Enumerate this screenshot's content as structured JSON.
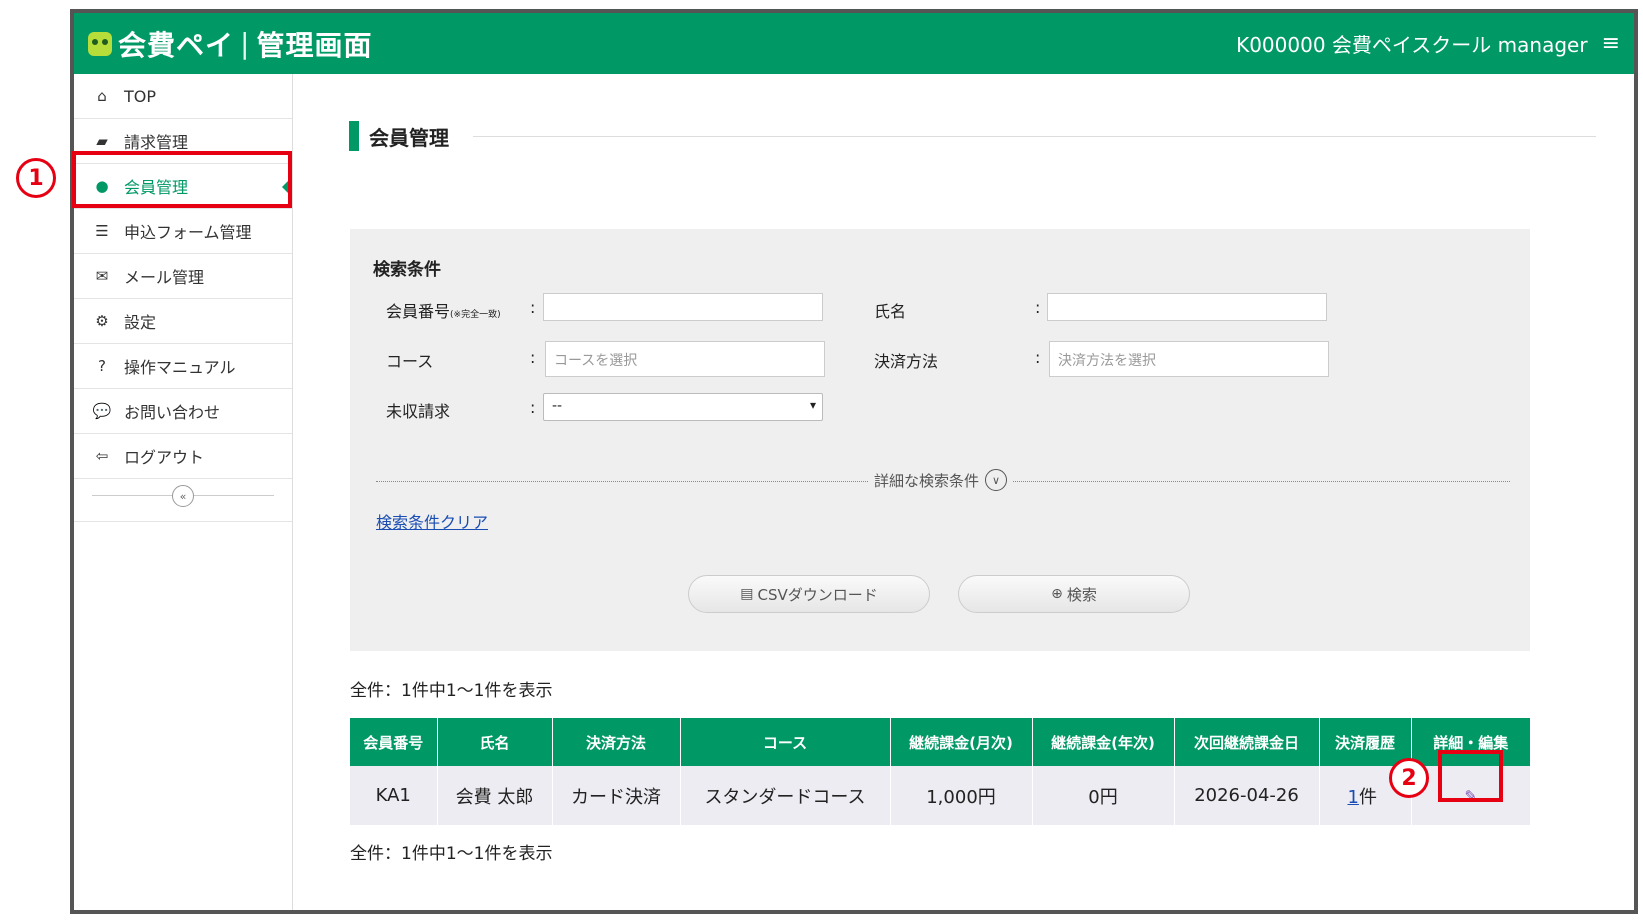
{
  "header": {
    "brand_main": "会費ペイ",
    "brand_sep": "|",
    "brand_sub": "管理画面",
    "user": "K000000 会費ペイスクール manager",
    "menu_icon": "≡"
  },
  "sidebar": {
    "items": [
      {
        "label": "TOP",
        "icon": "home-icon",
        "glyph": "⌂"
      },
      {
        "label": "請求管理",
        "icon": "book-icon",
        "glyph": "▰"
      },
      {
        "label": "会員管理",
        "icon": "user-icon",
        "glyph": "●",
        "active": true
      },
      {
        "label": "申込フォーム管理",
        "icon": "list-icon",
        "glyph": "☰"
      },
      {
        "label": "メール管理",
        "icon": "envelope-icon",
        "glyph": "✉"
      },
      {
        "label": "設定",
        "icon": "gears-icon",
        "glyph": "⚙"
      },
      {
        "label": "操作マニュアル",
        "icon": "question-icon",
        "glyph": "?"
      },
      {
        "label": "お問い合わせ",
        "icon": "chat-icon",
        "glyph": "💬"
      },
      {
        "label": "ログアウト",
        "icon": "logout-icon",
        "glyph": "⇦"
      }
    ],
    "collapse_glyph": "«"
  },
  "page": {
    "title": "会員管理"
  },
  "search": {
    "heading": "検索条件",
    "member_no_label": "会員番号",
    "member_no_note": "(※完全一致)",
    "name_label": "氏名",
    "course_label": "コース",
    "course_placeholder": "コースを選択",
    "payment_label": "決済方法",
    "payment_placeholder": "決済方法を選択",
    "unpaid_label": "未収請求",
    "unpaid_value": "--",
    "colon": ":",
    "detail_toggle": "詳細な検索条件",
    "clear_link": "検索条件クリア",
    "csv_button": "CSVダウンロード",
    "search_button": "検索"
  },
  "results": {
    "count_text": "全件：1件中1～1件を表示",
    "columns": [
      "会員番号",
      "氏名",
      "決済方法",
      "コース",
      "継続課金(月次)",
      "継続課金(年次)",
      "次回継続課金日",
      "決済履歴",
      "詳細・編集"
    ],
    "rows": [
      {
        "member_no": "KA1",
        "name": "会費 太郎",
        "payment": "カード決済",
        "course": "スタンダードコース",
        "monthly": "1,000円",
        "yearly": "0円",
        "next_date": "2026-04-26",
        "history_count": "1",
        "history_unit": "件"
      }
    ]
  },
  "annotations": {
    "step1": "1",
    "step2": "2"
  },
  "colors": {
    "brand": "#009966",
    "highlight": "#e60012"
  }
}
